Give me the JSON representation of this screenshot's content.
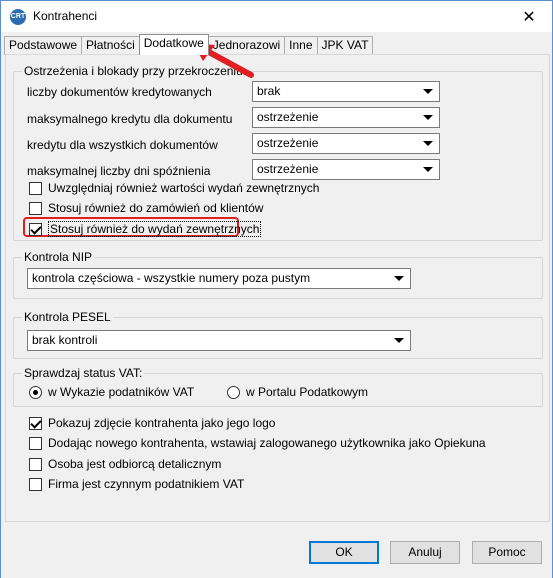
{
  "window": {
    "title": "Kontrahenci",
    "icon_text": "CRT",
    "close_symbol": "✕"
  },
  "tabs": [
    {
      "label": "Podstawowe",
      "active": false
    },
    {
      "label": "Płatności",
      "active": false
    },
    {
      "label": "Dodatkowe",
      "active": true
    },
    {
      "label": "Jednorazowi",
      "active": false
    },
    {
      "label": "Inne",
      "active": false
    },
    {
      "label": "JPK VAT",
      "active": false
    }
  ],
  "warnings": {
    "legend": "Ostrzeżenia i blokady przy przekroczeniu:",
    "rows": [
      {
        "label": "liczby dokumentów kredytowanych",
        "value": "brak"
      },
      {
        "label": "maksymalnego kredytu dla  dokumentu",
        "value": "ostrzeżenie"
      },
      {
        "label": "kredytu dla wszystkich dokumentów",
        "value": "ostrzeżenie"
      },
      {
        "label": "maksymalnej liczby dni spóźnienia",
        "value": "ostrzeżenie"
      }
    ],
    "checks": [
      {
        "label": "Uwzględniaj również wartości wydań zewnętrznych",
        "checked": false
      },
      {
        "label": "Stosuj również do zamówień od klientów",
        "checked": false
      },
      {
        "label": "Stosuj również do wydań zewnętrznych",
        "checked": true
      }
    ]
  },
  "nip": {
    "legend": "Kontrola NIP",
    "value": "kontrola częściowa - wszystkie numery poza pustym"
  },
  "pesel": {
    "legend": "Kontrola PESEL",
    "value": "brak kontroli"
  },
  "vat_status": {
    "legend": "Sprawdzaj status VAT:",
    "options": [
      {
        "label": "w Wykazie podatników VAT",
        "selected": true
      },
      {
        "label": "w Portalu Podatkowym",
        "selected": false
      }
    ]
  },
  "extra_checks": [
    {
      "label": "Pokazuj zdjęcie kontrahenta jako jego logo",
      "checked": true
    },
    {
      "label": "Dodając nowego kontrahenta, wstawiaj zalogowanego użytkownika jako Opiekuna",
      "checked": false
    },
    {
      "label": "Osoba jest odbiorcą detalicznym",
      "checked": false
    },
    {
      "label": "Firma jest czynnym podatnikiem VAT",
      "checked": false
    }
  ],
  "buttons": {
    "ok": "OK",
    "cancel": "Anuluj",
    "help": "Pomoc"
  },
  "colors": {
    "annotation": "#e02020",
    "focus_blue": "#0078d7"
  },
  "icons": {
    "app": "app-logo-icon",
    "close": "close-icon",
    "dropdown": "chevron-down-icon",
    "annotation": "red-arrow-icon"
  }
}
